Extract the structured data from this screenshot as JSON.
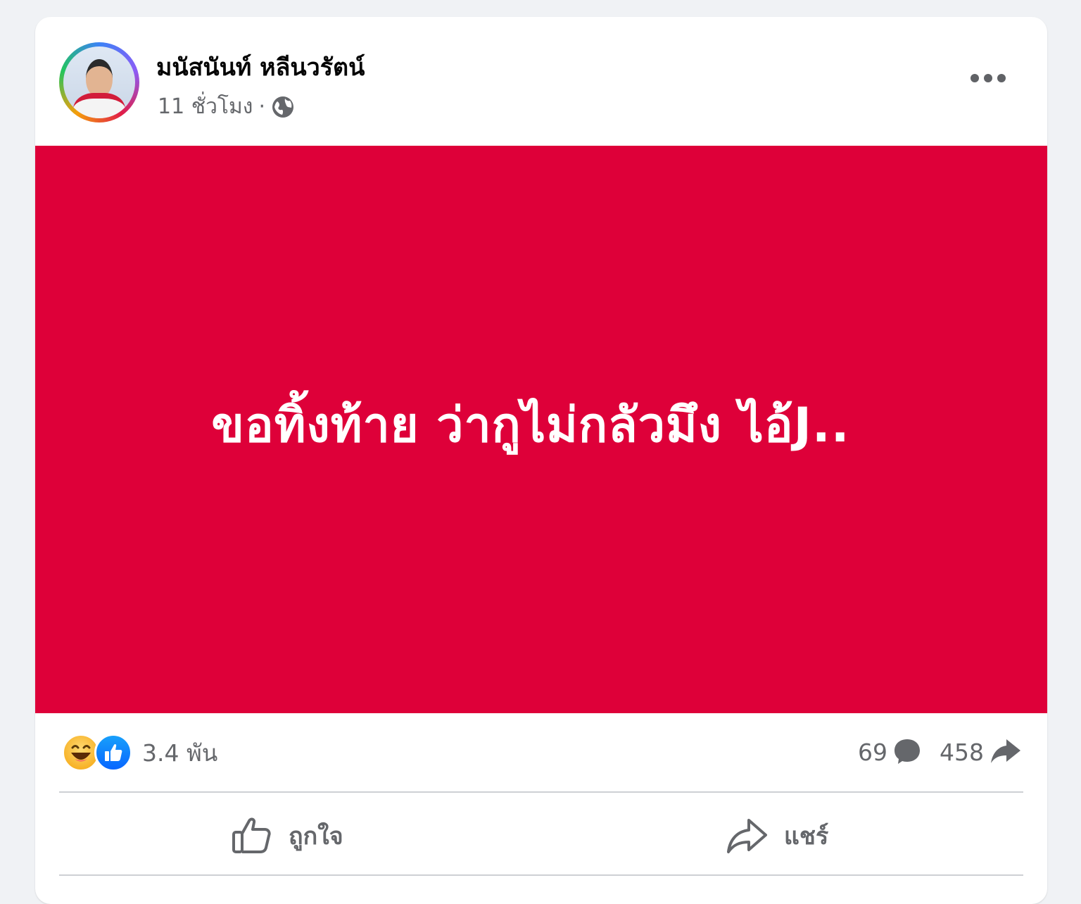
{
  "post": {
    "author": "มนัสนันท์ หลีนวรัตน์",
    "time": "11 ชั่วโมง",
    "meta_separator": "·",
    "privacy_icon": "globe-icon",
    "image_text": "ขอทิ้งท้าย ว่ากูไม่กลัวมึง ไอ้J..",
    "image_color": "#de0039"
  },
  "stats": {
    "reactions": "3.4 พัน",
    "reaction_icons": [
      "haha-icon",
      "like-icon"
    ],
    "comments": "69",
    "shares": "458"
  },
  "actions": {
    "like_label": "ถูกใจ",
    "share_label": "แชร์"
  }
}
